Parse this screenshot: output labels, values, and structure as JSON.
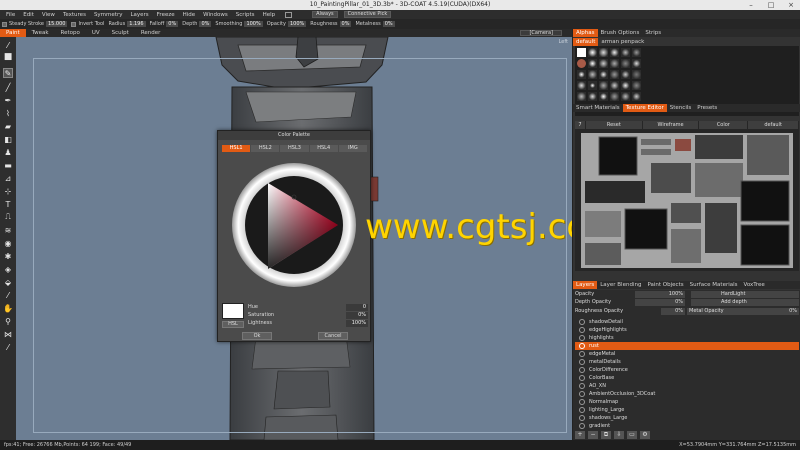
{
  "window": {
    "title": "10_PaintingPillar_01_3D.3b* - 3D-COAT 4.5.19(CUDA)(DX64)"
  },
  "menu": {
    "items": [
      "File",
      "Edit",
      "View",
      "Textures",
      "Symmetry",
      "Layers",
      "Freeze",
      "Hide",
      "Windows",
      "Scripts",
      "Help"
    ],
    "always": "Always",
    "connective": "Connective Pick"
  },
  "options": {
    "steady_stroke": "Steady Stroke",
    "steady_value": "15.000",
    "invert_tool": "Invert Tool",
    "radius_label": "Radius",
    "radius_value": "1.196",
    "falloff_label": "Falloff",
    "falloff_value": "0%",
    "depth_label": "Depth",
    "depth_value": "0%",
    "smoothing_label": "Smoothing",
    "smoothing_value": "100%",
    "opacity_label": "Opacity",
    "opacity_value": "100%",
    "roughness_label": "Roughness",
    "roughness_value": "0%",
    "metalness_label": "Metalness",
    "metalness_value": "0%"
  },
  "rooms": {
    "tabs": [
      "Paint",
      "Tweak",
      "Retopo",
      "UV",
      "Sculpt",
      "Render"
    ],
    "active": "Paint",
    "camera": "[Camera]"
  },
  "viewport": {
    "corner_label": "Left"
  },
  "palette": {
    "title": "Color Palette",
    "tabs": [
      "HSL1",
      "HSL2",
      "HSL3",
      "HSL4",
      "IMG"
    ],
    "active_tab": "HSL1",
    "swatch_color": "#ffffff",
    "hsl_button": "HSL",
    "hue_label": "Hue",
    "hue_value": "0",
    "saturation_label": "Saturation",
    "saturation_value": "0%",
    "lightness_label": "Lightness",
    "lightness_value": "100%",
    "ok": "Ok",
    "cancel": "Cancel"
  },
  "watermark": "www.cgtsj.com",
  "right_panel": {
    "top_tabs": [
      "Alphas",
      "Brush Options",
      "Strips"
    ],
    "alpha_preset": "default",
    "alpha_pack": "arman penpack",
    "mid_tabs": [
      "Smart Materials",
      "Texture Editor",
      "Stencils",
      "Presets"
    ],
    "mid_active": "Texture Editor",
    "tex_header": [
      "7",
      "Reset",
      "Wireframe",
      "Color",
      "default"
    ],
    "layer_tabs": [
      "Layers",
      "Layer Blending",
      "Paint Objects",
      "Surface Materials",
      "VoxTree"
    ],
    "layer_active": "Layers",
    "opacity_label": "Opacity",
    "opacity_value": "100%",
    "blend_mode": "HardLight",
    "depth_opacity_label": "Depth Opacity",
    "depth_opacity_value": "0%",
    "add_depth": "Add depth",
    "roughness_opacity_label": "Roughness Opacity",
    "roughness_opacity_value": "0%",
    "metal_opacity_label": "Metal Opacity",
    "metal_opacity_value": "0%",
    "layers": [
      "shadowDetail",
      "edgeHighlights",
      "highlights",
      "rust",
      "edgeMetal",
      "metalDetails",
      "ColorDifference",
      "ColorBase",
      "AO_XN",
      "AmbientOcclusion_3DCoat",
      "Normalmap",
      "lighting_Large",
      "shadows_Large",
      "gradient"
    ],
    "selected_layer": "rust"
  },
  "status": {
    "left": "fps:41;    Free: 26766 Mb,Points: 64 199; Face: 49/49",
    "right": "X=53.7904mm  Y=331.764mm  Z=17.5135mm"
  },
  "colors": {
    "accent": "#e25b14",
    "viewport_bg": "#6c7e93",
    "watermark": "#ffd400"
  }
}
